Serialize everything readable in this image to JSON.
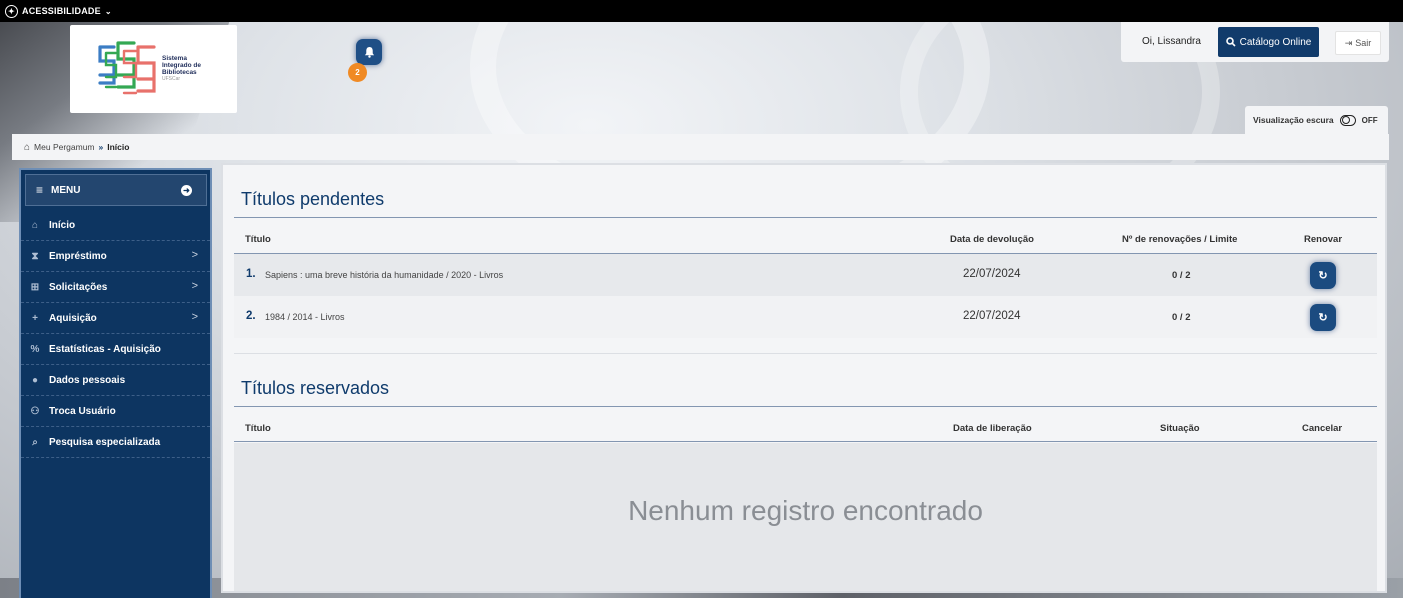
{
  "topbar": {
    "accessibility_label": "ACESSIBILIDADE",
    "accessibility_icon": "accessibility-icon",
    "chevron_icon": "chevron-down-icon"
  },
  "logo": {
    "line1": "Sistema",
    "line2": "Integrado de",
    "line3": "Bibliotecas",
    "line4": "UFSCar",
    "colors": [
      "#3b7dc4",
      "#34a853",
      "#e8716b"
    ]
  },
  "notifications": {
    "icon": "bell-icon",
    "count": "2",
    "badge_color": "#f08a24"
  },
  "user_bar": {
    "greeting": "Oi, Lissandra",
    "catalog_button": "Catálogo Online",
    "catalog_icon": "search-icon",
    "logout_button": "Sair",
    "logout_icon": "sign-out-icon"
  },
  "dark_mode": {
    "label": "Visualização escura",
    "state": "OFF"
  },
  "breadcrumb": {
    "home_icon": "home-icon",
    "home": "Meu Pergamum",
    "separator": "»",
    "current": "Início"
  },
  "menu": {
    "title": "MENU",
    "items": [
      {
        "label": "Início",
        "icon": "home-icon",
        "has_submenu": false
      },
      {
        "label": "Empréstimo",
        "icon": "hourglass-icon",
        "has_submenu": true
      },
      {
        "label": "Solicitações",
        "icon": "cart-icon",
        "has_submenu": true
      },
      {
        "label": "Aquisição",
        "icon": "plus-icon",
        "has_submenu": true
      },
      {
        "label": "Estatísticas - Aquisição",
        "icon": "percent-icon",
        "has_submenu": false
      },
      {
        "label": "Dados pessoais",
        "icon": "user-circle-icon",
        "has_submenu": false
      },
      {
        "label": "Troca Usuário",
        "icon": "users-icon",
        "has_submenu": false
      },
      {
        "label": "Pesquisa especializada",
        "icon": "search-icon",
        "has_submenu": false
      }
    ]
  },
  "pending": {
    "title": "Títulos pendentes",
    "columns": [
      "Título",
      "Data de devolução",
      "Nº de renovações / Limite",
      "Renovar"
    ],
    "rows": [
      {
        "num": "1.",
        "title": "Sapiens : uma breve história da humanidade / 2020 - Livros",
        "date": "22/07/2024",
        "renewals": "0 / 2"
      },
      {
        "num": "2.",
        "title": "1984 / 2014 - Livros",
        "date": "22/07/2024",
        "renewals": "0 / 2"
      }
    ]
  },
  "reserved": {
    "title": "Títulos reservados",
    "columns": [
      "Título",
      "Data de liberação",
      "Situação",
      "Cancelar"
    ],
    "empty_message": "Nenhum registro encontrado"
  },
  "colors": {
    "primary": "#113b6b",
    "sidebar": "#0d3561",
    "accent": "#f08a24"
  }
}
